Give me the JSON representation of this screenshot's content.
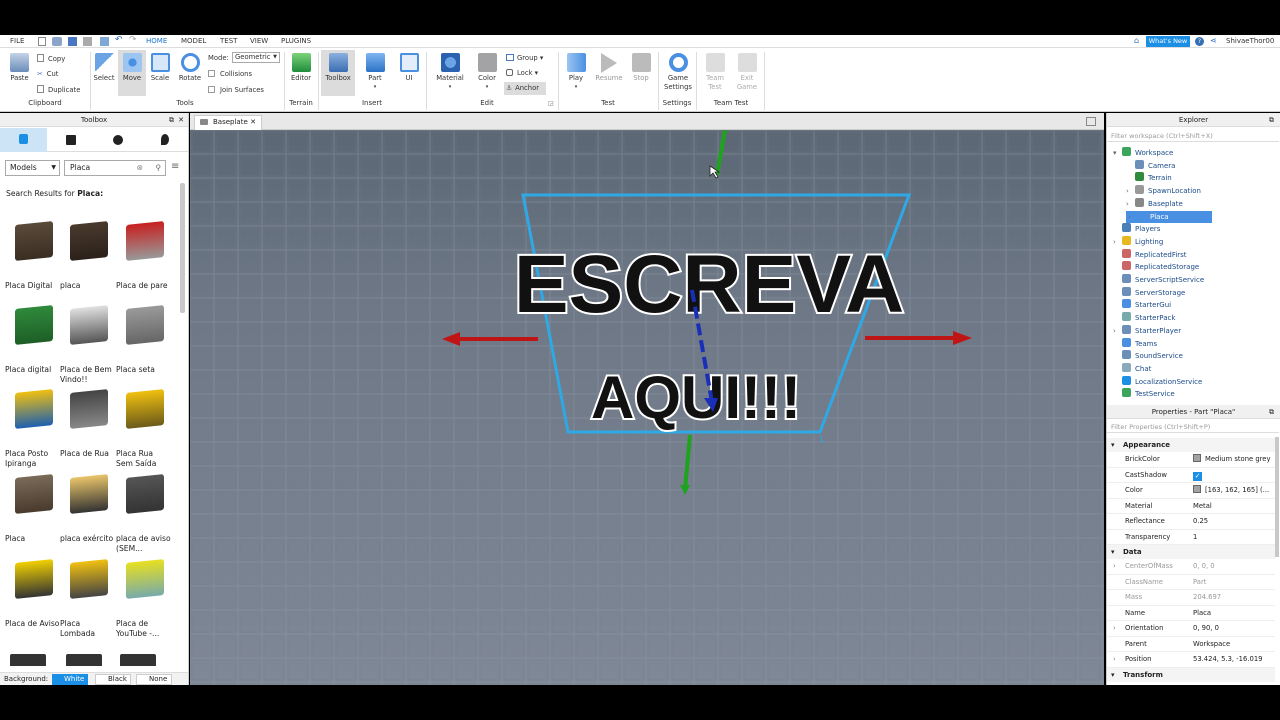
{
  "menubar": {
    "file": "FILE",
    "tabs": [
      "HOME",
      "MODEL",
      "TEST",
      "VIEW",
      "PLUGINS"
    ],
    "whats_new": "What's New",
    "username": "ShivaeThor00"
  },
  "ribbon": {
    "clipboard": {
      "paste": "Paste",
      "copy": "Copy",
      "cut": "Cut",
      "duplicate": "Duplicate",
      "label": "Clipboard"
    },
    "tools": {
      "select": "Select",
      "move": "Move",
      "scale": "Scale",
      "rotate": "Rotate",
      "mode_label": "Mode:",
      "mode_value": "Geometric",
      "collisions": "Collisions",
      "join_surfaces": "Join Surfaces",
      "label": "Tools"
    },
    "terrain": {
      "editor": "Editor",
      "label": "Terrain"
    },
    "insert": {
      "toolbox": "Toolbox",
      "part": "Part",
      "ui": "UI",
      "label": "Insert"
    },
    "edit": {
      "material": "Material",
      "color": "Color",
      "group": "Group",
      "lock": "Lock",
      "anchor": "Anchor",
      "label": "Edit"
    },
    "test": {
      "play": "Play",
      "resume": "Resume",
      "stop": "Stop",
      "label": "Test"
    },
    "settings": {
      "game": "Game",
      "settings": "Settings",
      "label": "Settings"
    },
    "team_test": {
      "team": "Team",
      "test": "Test",
      "exit": "Exit",
      "game": "Game",
      "label": "Team Test"
    }
  },
  "toolbox": {
    "title": "Toolbox",
    "category": "Models",
    "search_value": "Placa",
    "results_prefix": "Search Results for",
    "results_query": "Placa:",
    "items": [
      [
        "Placa Digital",
        "placa",
        "Placa de pare"
      ],
      [
        "Placa digital",
        "Placa de Bem Vindo!!",
        "Placa seta"
      ],
      [
        "Placa Posto Ipiranga",
        "Placa de Rua",
        "Placa Rua Sem Saída"
      ],
      [
        "Placa",
        "placa exército",
        "placa de aviso (SEM..."
      ],
      [
        "Placa de Aviso",
        "Placa Lombada",
        "Placa de YouTube -..."
      ]
    ],
    "background_label": "Background:",
    "bg_white": "White",
    "bg_black": "Black",
    "bg_none": "None"
  },
  "viewport": {
    "tab": "Baseplate",
    "sign_line1": "ESCREVA",
    "sign_line2": "AQUI!!!"
  },
  "explorer": {
    "title": "Explorer",
    "filter_placeholder": "Filter workspace (Ctrl+Shift+X)",
    "items": [
      "Workspace",
      "Camera",
      "Terrain",
      "SpawnLocation",
      "Baseplate",
      "Placa",
      "Players",
      "Lighting",
      "ReplicatedFirst",
      "ReplicatedStorage",
      "ServerScriptService",
      "ServerStorage",
      "StarterGui",
      "StarterPack",
      "StarterPlayer",
      "Teams",
      "SoundService",
      "Chat",
      "LocalizationService",
      "TestService"
    ]
  },
  "properties": {
    "title": "Properties - Part \"Placa\"",
    "filter_placeholder": "Filter Properties (Ctrl+Shift+P)",
    "appearance": "Appearance",
    "data": "Data",
    "transform": "Transform",
    "rows": [
      {
        "name": "BrickColor",
        "value": "Medium stone grey"
      },
      {
        "name": "CastShadow",
        "value": ""
      },
      {
        "name": "Color",
        "value": "[163, 162, 165] (..."
      },
      {
        "name": "Material",
        "value": "Metal"
      },
      {
        "name": "Reflectance",
        "value": "0.25"
      },
      {
        "name": "Transparency",
        "value": "1"
      },
      {
        "name": "CenterOfMass",
        "value": "0, 0, 0"
      },
      {
        "name": "ClassName",
        "value": "Part"
      },
      {
        "name": "Mass",
        "value": "204.697"
      },
      {
        "name": "Name",
        "value": "Placa"
      },
      {
        "name": "Orientation",
        "value": "0, 90, 0"
      },
      {
        "name": "Parent",
        "value": "Workspace"
      },
      {
        "name": "Position",
        "value": "53.424, 5.3, -16.019"
      }
    ]
  }
}
